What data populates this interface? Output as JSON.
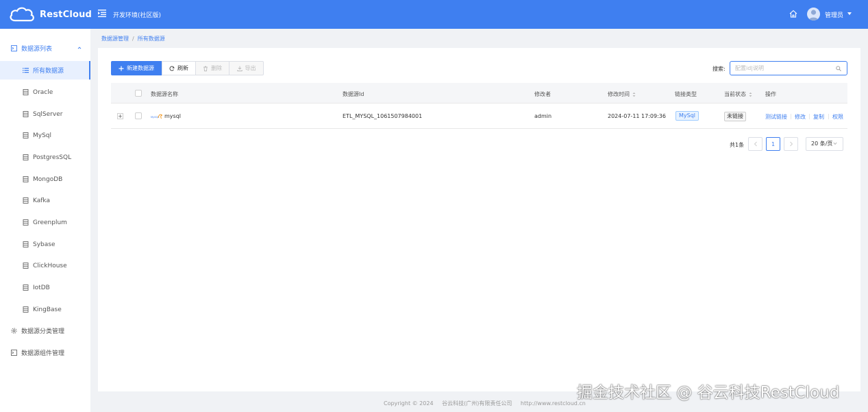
{
  "header": {
    "logo_text": "RestCloud",
    "env_title": "开发环境(社区版)",
    "user_name": "管理员"
  },
  "sidebar": {
    "group_label": "数据源列表",
    "items": [
      {
        "label": "所有数据源"
      },
      {
        "label": "Oracle"
      },
      {
        "label": "SqlServer"
      },
      {
        "label": "MySql"
      },
      {
        "label": "PostgresSQL"
      },
      {
        "label": "MongoDB"
      },
      {
        "label": "Kafka"
      },
      {
        "label": "Greenplum"
      },
      {
        "label": "Sybase"
      },
      {
        "label": "ClickHouse"
      },
      {
        "label": "IotDB"
      },
      {
        "label": "KingBase"
      }
    ],
    "category_label": "数据源分类管理",
    "component_label": "数据源组件管理"
  },
  "breadcrumb": {
    "root": "数据源管理",
    "sep": "/",
    "current": "所有数据源"
  },
  "toolbar": {
    "new_label": "新建数据源",
    "refresh_label": "刷新",
    "delete_label": "删除",
    "export_label": "导出",
    "search_label": "搜索:",
    "search_placeholder": "配置id|说明"
  },
  "table": {
    "columns": {
      "name": "数据源名称",
      "id": "数据源Id",
      "editor": "修改者",
      "modified": "修改时间",
      "link_type": "链接类型",
      "status": "当前状态",
      "actions": "操作"
    },
    "rows": [
      {
        "expand": "+",
        "logo": "MySQL",
        "name": "mysql",
        "id": "ETL_MYSQL_1061507984001",
        "editor": "admin",
        "modified": "2024-07-11 17:09:36",
        "link_type": "MySql",
        "status": "未链接",
        "actions": {
          "test": "测试链接",
          "edit": "修改",
          "copy": "复制",
          "perm": "权限"
        }
      }
    ]
  },
  "pagination": {
    "total": "共1条",
    "current": "1",
    "page_size": "20 条/页"
  },
  "footer": {
    "copyright": "Copyright © 2024",
    "company": "谷云科技(广州)有限责任公司",
    "url": "http://www.restcloud.cn"
  },
  "watermark": "掘金技术社区 @ 谷云科技RestCloud",
  "colors": {
    "primary": "#3f7ff0",
    "header_bg": "#3f7ff0",
    "active_bg": "#e8f0fe"
  }
}
